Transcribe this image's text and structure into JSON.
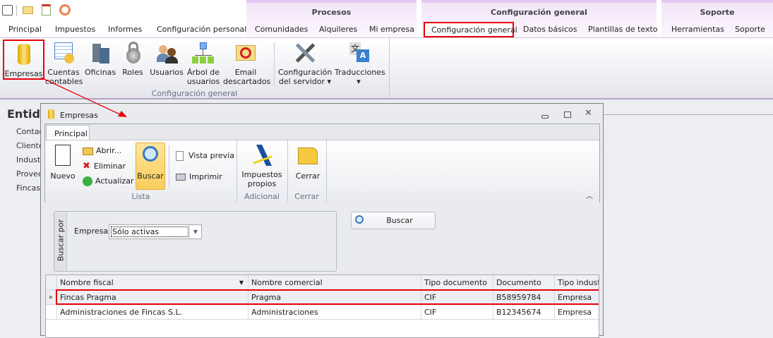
{
  "quick_access": {
    "icons": [
      "app-icon",
      "mail-icon",
      "clipboard-icon",
      "rss-icon"
    ]
  },
  "context_groups": [
    {
      "label": "Procesos"
    },
    {
      "label": "Configuración general"
    },
    {
      "label": "Soporte"
    }
  ],
  "tabs": [
    {
      "label": "Principal"
    },
    {
      "label": "Impuestos"
    },
    {
      "label": "Informes"
    },
    {
      "label": "Configuración personal"
    },
    {
      "label": "Comunidades"
    },
    {
      "label": "Alquileres"
    },
    {
      "label": "Mi empresa"
    },
    {
      "label": "Configuración general",
      "selected": true
    },
    {
      "label": "Datos básicos"
    },
    {
      "label": "Plantillas de texto"
    },
    {
      "label": "Herramientas"
    },
    {
      "label": "Soporte"
    }
  ],
  "ribbon": {
    "buttons": [
      {
        "l1": "Empresas",
        "l2": ""
      },
      {
        "l1": "Cuentas",
        "l2": "contables"
      },
      {
        "l1": "Oficinas",
        "l2": ""
      },
      {
        "l1": "Roles",
        "l2": ""
      },
      {
        "l1": "Usuarios",
        "l2": ""
      },
      {
        "l1": "Árbol de",
        "l2": "usuarios"
      },
      {
        "l1": "Email",
        "l2": "descartados"
      },
      {
        "l1": "Configuración",
        "l2": "del servidor ▾"
      },
      {
        "l1": "Traducciones",
        "l2": "▾"
      }
    ],
    "group_label": "Configuración general"
  },
  "side": {
    "title": "Entid",
    "items": [
      "Contac",
      "Cliente",
      "Industr",
      "Provee",
      "Fincas"
    ]
  },
  "dialog": {
    "title": "Empresas",
    "tab": "Principal",
    "lista": {
      "nuevo": "Nuevo",
      "abrir": "Abrir...",
      "eliminar": "Eliminar",
      "actualizar": "Actualizar",
      "buscar": "Buscar",
      "vista_previa": "Vista previa",
      "imprimir": "Imprimir",
      "label": "Lista"
    },
    "adicional": {
      "l1": "Impuestos",
      "l2": "propios",
      "label": "Adicional"
    },
    "cerrar": {
      "button": "Cerrar",
      "label": "Cerrar"
    },
    "search": {
      "group": "Buscar por",
      "empresa_label": "Empresa:",
      "empresa_value": "Sólo activas",
      "button": "Buscar"
    },
    "grid": {
      "columns": [
        "Nombre fiscal",
        "Nombre comercial",
        "Tipo documento",
        "Documento",
        "Tipo industri"
      ],
      "rows": [
        [
          "Fincas Pragma",
          "Pragma",
          "CIF",
          "B58959784",
          "Empresa"
        ],
        [
          "Administraciones de Fincas S.L.",
          "Administraciones",
          "CIF",
          "B12345674",
          "Empresa"
        ]
      ]
    }
  },
  "colors": {
    "highlight": "#e8000b",
    "context_header": "#f3e6f8",
    "active_button": "#fcd97a"
  }
}
